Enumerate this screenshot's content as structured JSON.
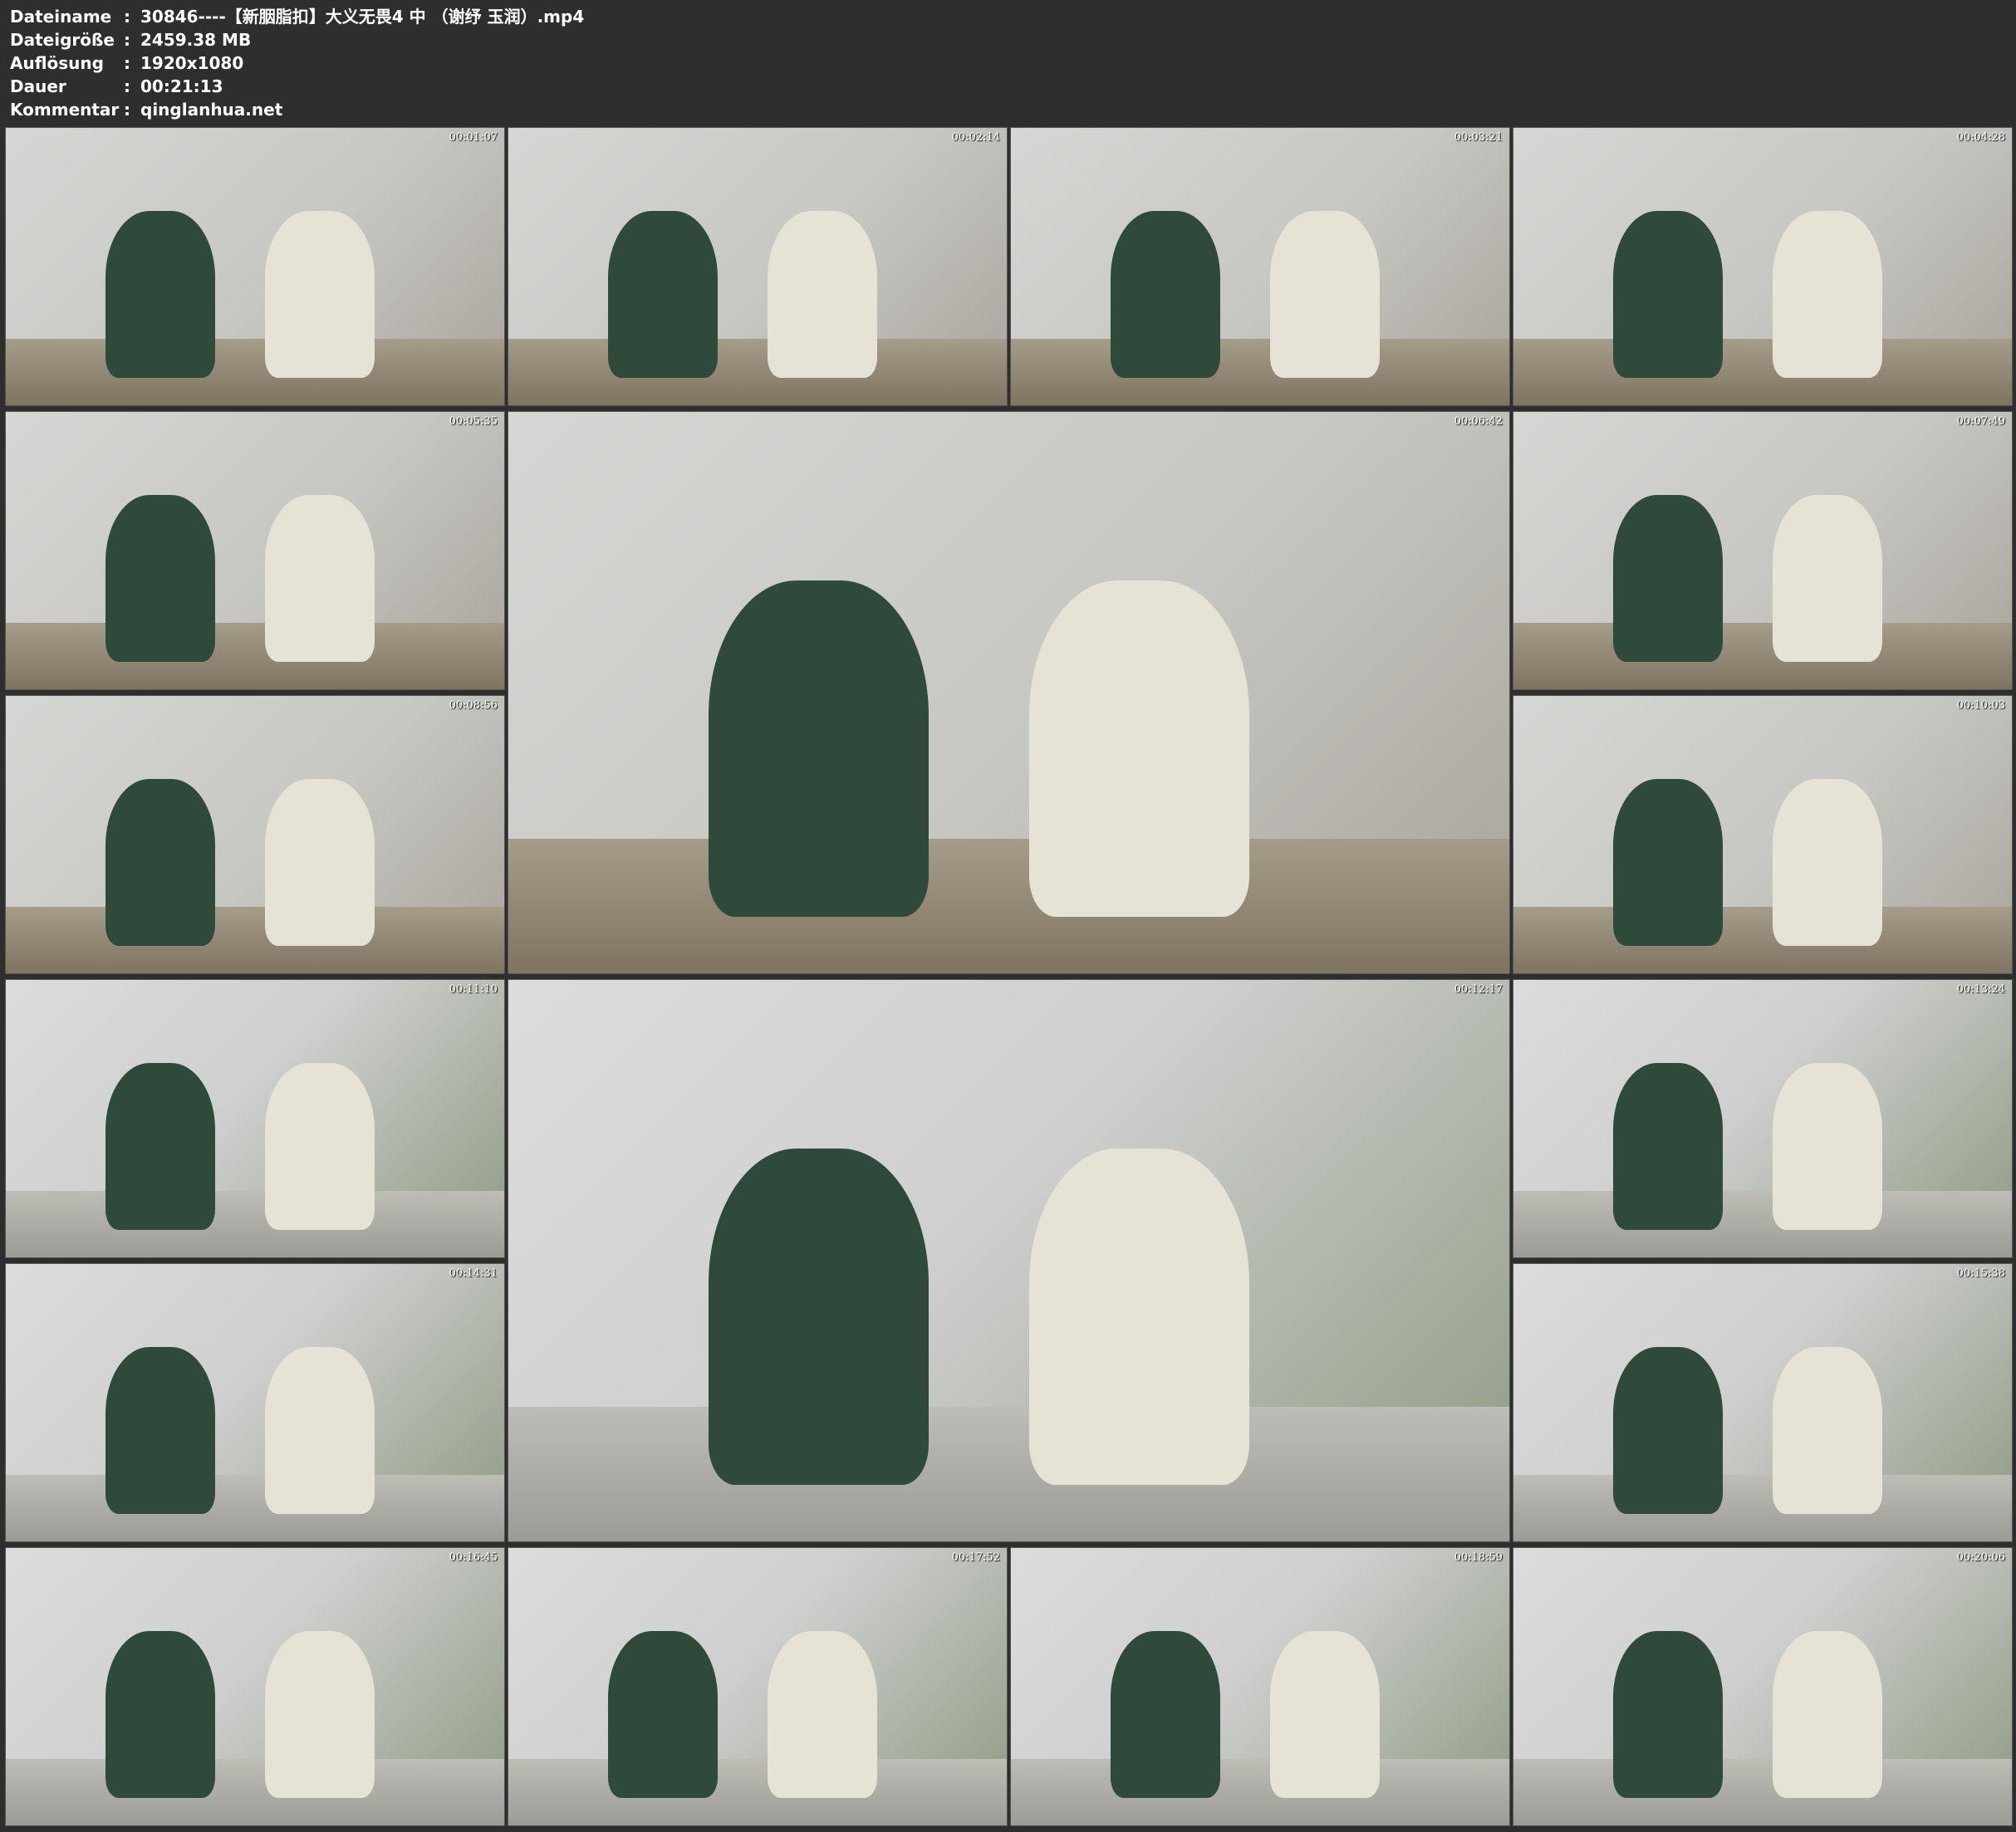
{
  "info": {
    "rows": [
      {
        "key": "Dateiname",
        "sep": ":",
        "value": "30846----【新胭脂扣】大义无畏4 中 （谢纾 玉润）.mp4"
      },
      {
        "key": "Dateigröße",
        "sep": ":",
        "value": "2459.38 MB"
      },
      {
        "key": "Auflösung",
        "sep": ":",
        "value": "1920x1080"
      },
      {
        "key": "Dauer",
        "sep": ":",
        "value": "00:21:13"
      },
      {
        "key": "Kommentar",
        "sep": ":",
        "value": "qinglanhua.net"
      }
    ]
  },
  "thumbnails": [
    {
      "time": "00:01:07",
      "scene": "indoor"
    },
    {
      "time": "00:02:14",
      "scene": "indoor"
    },
    {
      "time": "00:03:21",
      "scene": "indoor"
    },
    {
      "time": "00:04:28",
      "scene": "indoor"
    },
    {
      "time": "00:05:35",
      "scene": "indoor"
    },
    {
      "time": "00:06:42",
      "scene": "indoor"
    },
    {
      "time": "00:07:49",
      "scene": "indoor"
    },
    {
      "time": "00:08:56",
      "scene": "indoor"
    },
    {
      "time": "00:10:03",
      "scene": "indoor"
    },
    {
      "time": "00:11:10",
      "scene": "outdoor"
    },
    {
      "time": "00:12:17",
      "scene": "outdoor"
    },
    {
      "time": "00:13:24",
      "scene": "outdoor"
    },
    {
      "time": "00:14:31",
      "scene": "outdoor"
    },
    {
      "time": "00:15:38",
      "scene": "outdoor"
    },
    {
      "time": "00:16:45",
      "scene": "outdoor"
    },
    {
      "time": "00:17:52",
      "scene": "outdoor"
    },
    {
      "time": "00:18:59",
      "scene": "outdoor"
    },
    {
      "time": "00:20:06",
      "scene": "outdoor"
    }
  ]
}
